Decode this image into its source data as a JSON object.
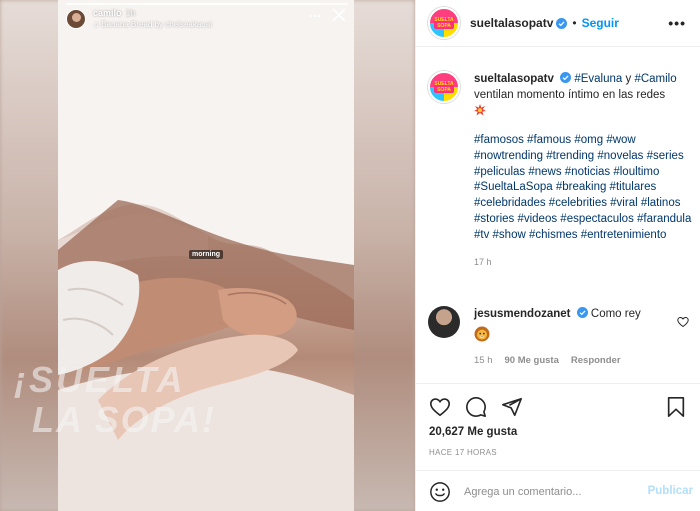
{
  "story": {
    "username": "camilo",
    "time": "1h",
    "music": "♫ Banana Bread by chelseakauai",
    "sticker": "morning",
    "watermark_line1": "¡SUELTA",
    "watermark_line2": "LA SOPA!"
  },
  "post": {
    "username": "sueltalasopatv",
    "dot": "•",
    "follow_label": "Seguir",
    "more_label": "•••",
    "avatar_text": "SUELTA SOPA"
  },
  "caption": {
    "username": "sueltalasopatv",
    "tag1": "#Evaluna",
    "connector": "y",
    "tag2": "#Camilo",
    "text": "ventilan momento íntimo en las redes",
    "hashtags": "#famosos #famous #omg #wow #nowtrending #trending #novelas #series #peliculas #news #noticias #loultimo #SueltaLaSopa #breaking #titulares #celebridades #celebrities #viral #latinos #stories #videos #espectaculos #farandula #tv #show #chismes #entretenimiento",
    "time": "17 h"
  },
  "comment": {
    "username": "jesusmendozanet",
    "text": "Como rey",
    "time": "15 h",
    "likes": "90 Me gusta",
    "reply_label": "Responder"
  },
  "actions": {
    "likes": "20,627 Me gusta",
    "ago": "HACE 17 HORAS",
    "comment_placeholder": "Agrega un comentario...",
    "publish_label": "Publicar"
  },
  "colors": {
    "link": "#00376b",
    "accent": "#0095f6",
    "muted": "#8e8e8e"
  },
  "icons": [
    "heart-icon",
    "comment-icon",
    "share-icon",
    "bookmark-icon",
    "emoji-icon",
    "verified-icon",
    "close-icon",
    "lion-emoji",
    "collision-emoji"
  ]
}
